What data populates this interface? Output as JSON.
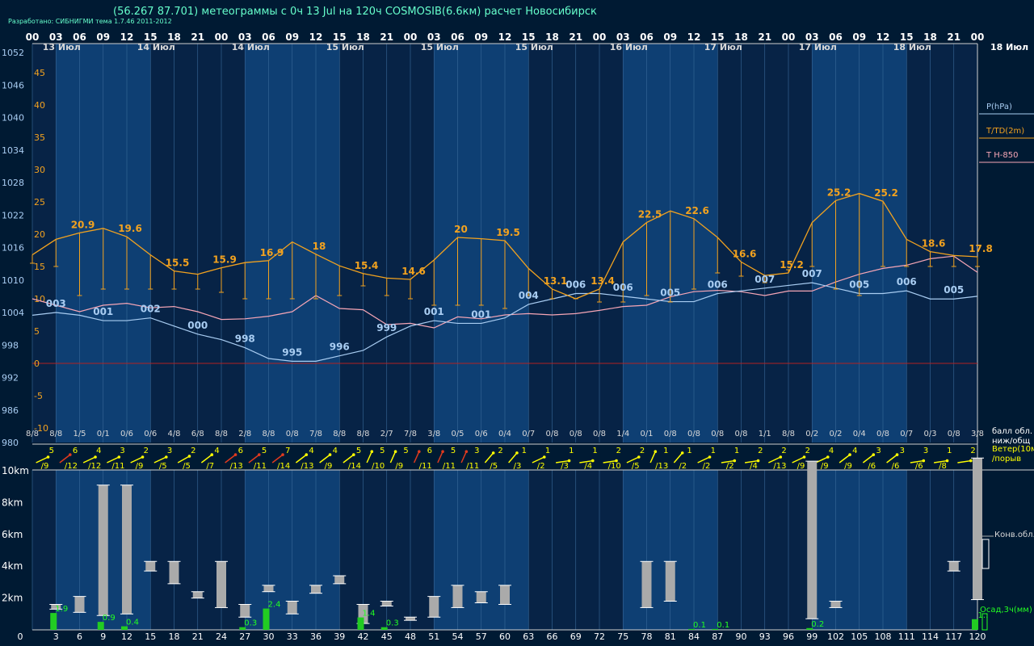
{
  "header": {
    "title": "(56.267 87.701) метеограммы с  0ч 13 Jul на 120ч COSMOSIB(6.6км) расчет Новосибирск",
    "developer": "Разработано: СИБНИГМИ тема 1.7.46 2011-2012"
  },
  "colors": {
    "background": "#001a33",
    "day_band": "#0e3f73",
    "night_band": "#072346",
    "pressure": "#a9cdf2",
    "temperature": "#f2a21f",
    "t850": "#f7a6b6",
    "wind": "#ffff00",
    "wind_strong": "#e03a1e",
    "precip": "#22cc22",
    "cloud_bar": "#aaaaaa",
    "frost_line": "#b22222"
  },
  "chart_data": [
    {
      "type": "line",
      "panel": "main",
      "hours": [
        0,
        3,
        6,
        9,
        12,
        15,
        18,
        21,
        24,
        27,
        30,
        33,
        36,
        39,
        42,
        45,
        48,
        51,
        54,
        57,
        60,
        63,
        66,
        69,
        72,
        75,
        78,
        81,
        84,
        87,
        90,
        93,
        96,
        99,
        102,
        105,
        108,
        111,
        114,
        117,
        120
      ],
      "top_hour_labels": [
        "00",
        "03",
        "06",
        "09",
        "12",
        "15",
        "18",
        "21",
        "00",
        "03",
        "06",
        "09",
        "12",
        "15",
        "18",
        "21",
        "00",
        "03",
        "06",
        "09",
        "12",
        "15",
        "18",
        "21",
        "00",
        "03",
        "06",
        "09",
        "12",
        "15",
        "18",
        "21",
        "00",
        "03",
        "06",
        "09",
        "12",
        "15",
        "18",
        "21",
        "00"
      ],
      "date_labels": [
        {
          "hour": 1,
          "label": "13 Июл"
        },
        {
          "hour": 13,
          "label": "14 Июл"
        },
        {
          "hour": 25,
          "label": "14 Июл"
        },
        {
          "hour": 37,
          "label": "15 Июл"
        },
        {
          "hour": 49,
          "label": "15 Июл"
        },
        {
          "hour": 61,
          "label": "15 Июл"
        },
        {
          "hour": 73,
          "label": "16 Июл"
        },
        {
          "hour": 85,
          "label": "17 Июл"
        },
        {
          "hour": 97,
          "label": "17 Июл"
        },
        {
          "hour": 109,
          "label": "18 Июл"
        }
      ],
      "date_label_right": "18 Июл",
      "pressure_axis": {
        "label": "P(hPa)",
        "range": [
          980,
          1052
        ],
        "ticks": [
          1052,
          1046,
          1040,
          1034,
          1028,
          1022,
          1016,
          1010,
          1004,
          998,
          992,
          986,
          980
        ]
      },
      "temperature_axis": {
        "label": "T/TD(2m)",
        "range": [
          -10,
          45
        ],
        "ticks": [
          45,
          40,
          35,
          30,
          25,
          20,
          15,
          10,
          5,
          0,
          -5,
          -10
        ]
      },
      "t850_label": "T H-850",
      "series": [
        {
          "name": "P(hPa)",
          "key": "pressure",
          "values": [
            1003.5,
            1004,
            1003.5,
            1002.5,
            1002.5,
            1003,
            1001.5,
            1000,
            999,
            997.5,
            995.5,
            995,
            995,
            996,
            997,
            999.5,
            1001.5,
            1002.5,
            1002,
            1002,
            1003,
            1005.5,
            1006.5,
            1007.5,
            1007.5,
            1007,
            1006.5,
            1006,
            1006,
            1007.5,
            1008,
            1008.5,
            1009,
            1009.5,
            1008.5,
            1007.5,
            1007.5,
            1008,
            1006.5,
            1006.5,
            1007
          ],
          "labels": [
            {
              "hour": 3,
              "text": "003"
            },
            {
              "hour": 9,
              "text": "001"
            },
            {
              "hour": 15,
              "text": "002"
            },
            {
              "hour": 21,
              "text": "000"
            },
            {
              "hour": 27,
              "text": "998"
            },
            {
              "hour": 33,
              "text": "995"
            },
            {
              "hour": 39,
              "text": "996"
            },
            {
              "hour": 45,
              "text": "999"
            },
            {
              "hour": 51,
              "text": "001"
            },
            {
              "hour": 57,
              "text": "001"
            },
            {
              "hour": 63,
              "text": "004"
            },
            {
              "hour": 69,
              "text": "006"
            },
            {
              "hour": 75,
              "text": "006"
            },
            {
              "hour": 81,
              "text": "005"
            },
            {
              "hour": 87,
              "text": "006"
            },
            {
              "hour": 93,
              "text": "007"
            },
            {
              "hour": 99,
              "text": "007"
            },
            {
              "hour": 105,
              "text": "005"
            },
            {
              "hour": 111,
              "text": "006"
            },
            {
              "hour": 117,
              "text": "005"
            }
          ]
        },
        {
          "name": "T(2m)",
          "key": "temperature",
          "values": [
            16.8,
            19.2,
            20.2,
            20.9,
            19.6,
            16.8,
            14.3,
            13.8,
            14.8,
            15.6,
            15.9,
            18.8,
            16.9,
            15.1,
            13.9,
            13.2,
            13.0,
            16.0,
            19.5,
            19.3,
            19.0,
            14.7,
            11.5,
            10.0,
            11.5,
            18.8,
            21.8,
            23.6,
            22.4,
            19.5,
            15.7,
            13.6,
            14.0,
            21.8,
            25.2,
            26.3,
            25.1,
            19.2,
            17.3,
            16.7,
            16.5
          ],
          "labels": [
            {
              "hour": 6,
              "text": "20.9"
            },
            {
              "hour": 12,
              "text": "19.6"
            },
            {
              "hour": 18,
              "text": "15.5"
            },
            {
              "hour": 24,
              "text": "15.9"
            },
            {
              "hour": 30,
              "text": "16.9"
            },
            {
              "hour": 36,
              "text": "18"
            },
            {
              "hour": 42,
              "text": "15.4"
            },
            {
              "hour": 48,
              "text": "14.6"
            },
            {
              "hour": 54,
              "text": "20"
            },
            {
              "hour": 60,
              "text": "19.5"
            },
            {
              "hour": 66,
              "text": "13.1"
            },
            {
              "hour": 72,
              "text": "13.4"
            },
            {
              "hour": 78,
              "text": "22.5"
            },
            {
              "hour": 84,
              "text": "22.6"
            },
            {
              "hour": 90,
              "text": "16.6"
            },
            {
              "hour": 96,
              "text": "15.2"
            },
            {
              "hour": 102,
              "text": "25.2"
            },
            {
              "hour": 108,
              "text": "25.2"
            },
            {
              "hour": 114,
              "text": "18.6"
            },
            {
              "hour": 120,
              "text": "17.8"
            }
          ]
        },
        {
          "name": "TD(2m)",
          "key": "dewpoint",
          "values": [
            15.5,
            15.0,
            10.5,
            11.5,
            11.5,
            11.5,
            11.5,
            11.5,
            11.0,
            10.0,
            10.0,
            10.0,
            10.0,
            10.5,
            12.0,
            10.5,
            10.0,
            9.0,
            9.0,
            9.0,
            8.5,
            10.5,
            10.0,
            10.0,
            9.5,
            9.5,
            10.5,
            9.5,
            11.5,
            14.0,
            13.5,
            12.5,
            14.5,
            15.0,
            11.5,
            10.5,
            15.0,
            15.0,
            15.0,
            15.0,
            15.0
          ]
        },
        {
          "name": "T H-850",
          "key": "t850",
          "values": [
            10,
            9,
            8,
            9,
            9.3,
            8.6,
            8.8,
            8,
            6.8,
            6.9,
            7.3,
            8,
            10.5,
            8.5,
            8.3,
            6,
            6.2,
            5.5,
            7.2,
            6.9,
            7.5,
            7.7,
            7.5,
            7.7,
            8.2,
            8.8,
            9,
            10.3,
            11.1,
            11.3,
            11.1,
            10.5,
            11.2,
            11.2,
            12.6,
            13.8,
            14.7,
            15.2,
            16.2,
            16.6,
            14.1
          ]
        }
      ],
      "cloud_row": {
        "label": "балл обл. ниж/общ",
        "values": [
          "8/8",
          "8/8",
          "1/5",
          "0/1",
          "0/6",
          "0/6",
          "4/8",
          "6/8",
          "8/8",
          "2/8",
          "8/8",
          "0/8",
          "7/8",
          "8/8",
          "8/8",
          "2/7",
          "7/8",
          "3/8",
          "0/5",
          "0/6",
          "0/4",
          "0/7",
          "0/8",
          "0/8",
          "0/8",
          "1/4",
          "0/1",
          "0/8",
          "0/8",
          "0/8",
          "0/8",
          "1/1",
          "8/8",
          "0/2",
          "0/2",
          "0/4",
          "0/8",
          "0/7",
          "0/3",
          "0/8",
          "3/8"
        ]
      },
      "wind_row": {
        "label": "Ветер(10м) /порыв",
        "speed": [
          "5",
          "6",
          "4",
          "3",
          "2",
          "3",
          "2",
          "4",
          "6",
          "5",
          "7",
          "4",
          "4",
          "5",
          "5",
          "5",
          "6",
          "5",
          "3",
          "2",
          "1",
          "1",
          "1",
          "1",
          "2",
          "2",
          "1",
          "1",
          "1",
          "1",
          "2",
          "2",
          "2",
          "4",
          "4",
          "3",
          "3",
          "3",
          "1",
          "2"
        ],
        "gust": [
          "/9",
          "/12",
          "/12",
          "/11",
          "/9",
          "/5",
          "/5",
          "/7",
          "/13",
          "/11",
          "/14",
          "/13",
          "/9",
          "/14",
          "/10",
          "/9",
          "/11",
          "/11",
          "/11",
          "/5",
          "/3",
          "/2",
          "/3",
          "/4",
          "/10",
          "/5",
          "/13",
          "/2",
          "/2",
          "/2",
          "/4",
          "/13",
          "/9",
          "/9",
          "/9",
          "/6",
          "/6",
          "/6",
          "/8"
        ],
        "strong": [
          false,
          true,
          false,
          false,
          false,
          false,
          false,
          false,
          true,
          true,
          true,
          false,
          false,
          false,
          false,
          false,
          true,
          true,
          true,
          false,
          false,
          false,
          false,
          false,
          false,
          false,
          false,
          false,
          false,
          false,
          false,
          false,
          false,
          false,
          false,
          false,
          false,
          false,
          false,
          false
        ],
        "direction_deg": [
          30,
          45,
          30,
          30,
          30,
          30,
          35,
          45,
          45,
          45,
          45,
          45,
          45,
          45,
          80,
          80,
          80,
          80,
          80,
          60,
          60,
          30,
          10,
          10,
          10,
          30,
          80,
          60,
          30,
          10,
          10,
          30,
          30,
          30,
          45,
          45,
          45,
          10,
          10,
          10
        ]
      }
    },
    {
      "type": "bar",
      "panel": "convection",
      "x_ticks": [
        3,
        6,
        9,
        12,
        15,
        18,
        21,
        24,
        27,
        30,
        33,
        36,
        39,
        42,
        45,
        48,
        51,
        54,
        57,
        60,
        63,
        66,
        69,
        72,
        75,
        78,
        81,
        84,
        87,
        90,
        93,
        96,
        99,
        102,
        105,
        108,
        111,
        114,
        117,
        120
      ],
      "height_axis": {
        "ticks": [
          "10km",
          "8km",
          "6km",
          "4km",
          "2km"
        ],
        "range_km": [
          0,
          10.8
        ]
      },
      "convective_cloud_label": "Конв.обл.",
      "precip_label": "Осад,3ч(мм)",
      "cloud_bars": [
        {
          "hour": 3,
          "base_km": 1.3,
          "top_km": 1.6
        },
        {
          "hour": 6,
          "base_km": 1.1,
          "top_km": 2.1
        },
        {
          "hour": 9,
          "base_km": 0.9,
          "top_km": 9.1
        },
        {
          "hour": 12,
          "base_km": 1.0,
          "top_km": 9.1
        },
        {
          "hour": 15,
          "base_km": 3.7,
          "top_km": 4.3
        },
        {
          "hour": 18,
          "base_km": 2.9,
          "top_km": 4.3
        },
        {
          "hour": 21,
          "base_km": 2.0,
          "top_km": 2.4
        },
        {
          "hour": 24,
          "base_km": 1.4,
          "top_km": 4.3
        },
        {
          "hour": 27,
          "base_km": 0.8,
          "top_km": 1.6
        },
        {
          "hour": 30,
          "base_km": 2.4,
          "top_km": 2.8
        },
        {
          "hour": 33,
          "base_km": 1.0,
          "top_km": 1.8
        },
        {
          "hour": 36,
          "base_km": 2.3,
          "top_km": 2.8
        },
        {
          "hour": 39,
          "base_km": 2.9,
          "top_km": 3.4
        },
        {
          "hour": 42,
          "base_km": 0.4,
          "top_km": 1.6
        },
        {
          "hour": 45,
          "base_km": 1.5,
          "top_km": 1.8
        },
        {
          "hour": 48,
          "base_km": 0.6,
          "top_km": 0.8
        },
        {
          "hour": 51,
          "base_km": 0.8,
          "top_km": 2.1
        },
        {
          "hour": 54,
          "base_km": 1.4,
          "top_km": 2.8
        },
        {
          "hour": 57,
          "base_km": 1.7,
          "top_km": 2.4
        },
        {
          "hour": 60,
          "base_km": 1.6,
          "top_km": 2.8
        },
        {
          "hour": 78,
          "base_km": 1.4,
          "top_km": 4.3
        },
        {
          "hour": 81,
          "base_km": 1.8,
          "top_km": 4.3
        },
        {
          "hour": 99,
          "base_km": 0.7,
          "top_km": 10.6
        },
        {
          "hour": 102,
          "base_km": 1.4,
          "top_km": 1.8
        },
        {
          "hour": 117,
          "base_km": 3.7,
          "top_km": 4.3
        },
        {
          "hour": 120,
          "base_km": 1.9,
          "top_km": 11.5
        }
      ],
      "precip": [
        {
          "hour": 3,
          "mm": 1.9,
          "label": "1.9"
        },
        {
          "hour": 9,
          "mm": 0.9,
          "label": "0.9"
        },
        {
          "hour": 12,
          "mm": 0.4,
          "label": "0.4"
        },
        {
          "hour": 27,
          "mm": 0.3,
          "label": "0.3"
        },
        {
          "hour": 30,
          "mm": 2.4,
          "label": "2.4"
        },
        {
          "hour": 42,
          "mm": 1.4,
          "label": "1.4"
        },
        {
          "hour": 45,
          "mm": 0.3,
          "label": "0.3"
        },
        {
          "hour": 84,
          "mm": 0.1,
          "label": "0.1"
        },
        {
          "hour": 87,
          "mm": 0.1,
          "label": "0.1"
        },
        {
          "hour": 99,
          "mm": 0.2,
          "label": "0.2"
        },
        {
          "hour": 120,
          "mm": 1.2,
          "label": "1.:"
        }
      ]
    }
  ]
}
